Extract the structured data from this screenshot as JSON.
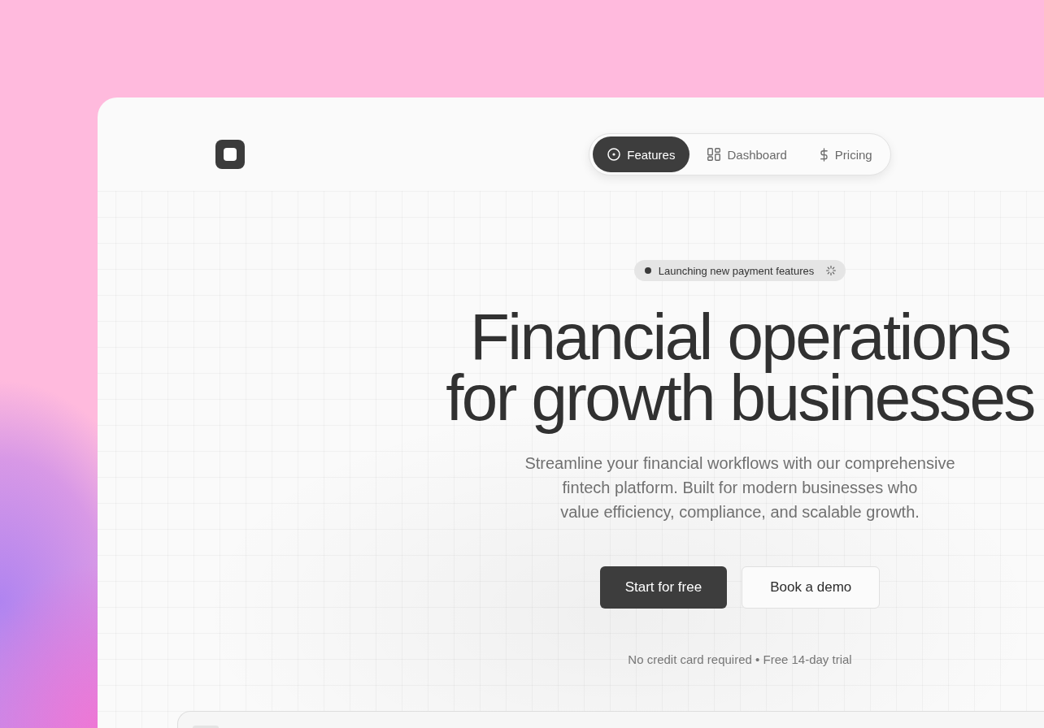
{
  "nav": {
    "tabs": [
      {
        "label": "Features",
        "selected": true
      },
      {
        "label": "Dashboard",
        "selected": false
      },
      {
        "label": "Pricing",
        "selected": false
      }
    ]
  },
  "badge": {
    "text": "Launching new payment features"
  },
  "headline": {
    "lines": [
      "Financial operations",
      "for growth businesses"
    ]
  },
  "subtitle": {
    "lines": [
      "Streamline your financial workflows with our comprehensive",
      "fintech platform. Built for modern businesses who",
      "value efficiency, compliance, and scalable growth."
    ]
  },
  "buttons": [
    {
      "label": "Start for free",
      "kind": "primary"
    },
    {
      "label": "Book a demo",
      "kind": "secondary"
    }
  ],
  "note": "No credit card required • Free 14-day trial"
}
